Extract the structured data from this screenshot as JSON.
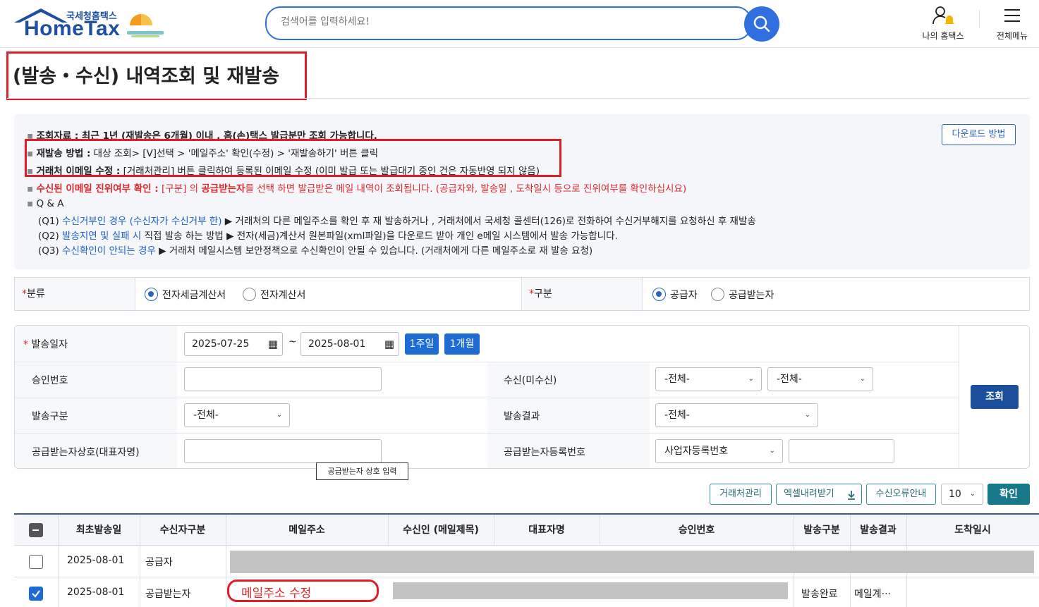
{
  "header": {
    "logo_small": "국세청홈택스",
    "logo_big": "HomeTax",
    "search_placeholder": "검색어를 입력하세요!",
    "my_hometax": "나의 홈택스",
    "all_menu": "전체메뉴"
  },
  "page_title": "(발송・수신) 내역조회 및 재발송",
  "notice": {
    "line1": "조회자료 : 최근 1년 (재발송은 6개월) 이내 , 홈(손)택스 발급분만 조회 가능합니다.",
    "line2_label": "재발송 방법 :",
    "line2_text": " 대상 조회>   [V]선택   > '메일주소' 확인(수정)   >   '재발송하기' 버튼 클릭",
    "line3_label": "거래처 이메일 수정 :",
    "line3_text": " [거래처관리] 버튼 클릭하여 등록된 이메일 수정 (이미 발급 또는 발급대기 중인 건은 자동반영 되지 않음)",
    "line4_label": "수신된 이메일 진위여부 확인 :",
    "line4_text": " [구분] 의 ",
    "line4_strong": "공급받는자",
    "line4_text2": "를 선택 하면 발급받은  메일 내역이 조회됩니다. (공급자와,  발송일 , 도착일시 등으로 진위여부를 확인하십시요)",
    "qa": "Q & A",
    "q1_num": "(Q1) ",
    "q1_blue": "수신거부인 경우 (수신자가 수신거부 한)",
    "q1_text": " ▶ 거래처의 다른 메일주소를 확인 후 재 발송하거나 , 거래처에서 국세청 콜센터(126)로 전화하여 수신거부해지를  요청하신 후 재발송",
    "q2_num": "(Q2) ",
    "q2_blue": "발송지연 및 실패 시",
    "q2_text": " 직접 발송 하는 방법  ▶ 전자(세금)계산서 원본파일(xml파일)을 다운로드 받아 개인 e메일 시스템에서 발송 가능합니다.",
    "q3_num": "(Q3) ",
    "q3_blue": "수신확인이 안되는 경우",
    "q3_text": " ▶ 거래처 메일시스템 보안정책으로 수신확인이 안될 수 있습니다. (거래처에게 다른 메일주소로 재 발송 요청)",
    "download_btn": "다운로드 방법"
  },
  "classification": {
    "label": "분류",
    "opt1": "전자세금계산서",
    "opt2": "전자계산서",
    "selected": "전자세금계산서",
    "div_label": "구분",
    "div_opt1": "공급자",
    "div_opt2": "공급받는자",
    "div_selected": "공급자"
  },
  "form": {
    "send_date_label": "발송일자",
    "date_from": "2025-07-25",
    "date_tilde": "~",
    "date_to": "2025-08-01",
    "btn_week": "1주일",
    "btn_month": "1개월",
    "approval_label": "승인번호",
    "receive_label": "수신(미수신)",
    "receive_sel1": "-전체-",
    "receive_sel2": "-전체-",
    "send_type_label": "발송구분",
    "send_type_sel": "-전체-",
    "send_result_label": "발송결과",
    "send_result_sel": "-전체-",
    "buyer_name_label": "공급받는자상호(대표자명)",
    "buyer_reg_label": "공급받는자등록번호",
    "buyer_reg_sel": "사업자등록번호",
    "search_btn": "조회",
    "tooltip": "공급받는자 상호 입력"
  },
  "toolbar": {
    "partner_btn": "거래처관리",
    "excel_btn": "엑셀내려받기",
    "error_btn": "수신오류안내",
    "page_size": "10",
    "confirm_btn": "확인"
  },
  "table": {
    "headers": [
      "최초발송일",
      "수신자구분",
      "메일주소",
      "수신인 (메일제목)",
      "대표자명",
      "승인번호",
      "발송구분",
      "발송결과",
      "도착일시"
    ],
    "rows": [
      {
        "date": "2025-08-01",
        "recipient_type": "공급자",
        "checked": false,
        "send_type": "",
        "result": ""
      },
      {
        "date": "2025-08-01",
        "recipient_type": "공급받는자",
        "checked": true,
        "email_hint": "메일주소 수정",
        "send_type": "발송완료",
        "result": "메일계···"
      }
    ]
  }
}
